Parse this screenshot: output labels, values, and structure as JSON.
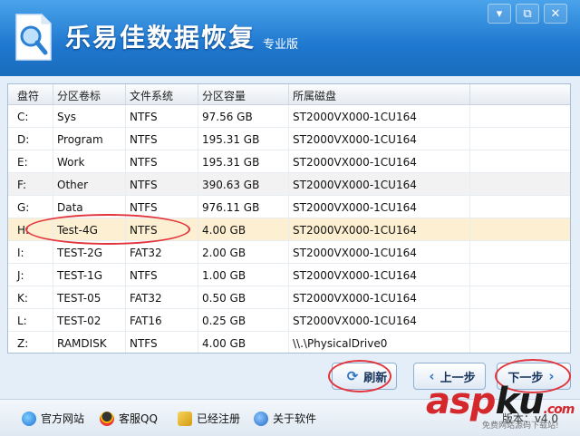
{
  "app": {
    "title": "乐易佳数据恢复",
    "edition": "专业版"
  },
  "window_controls": {
    "menu": "▾",
    "restore": "⧉",
    "close": "✕"
  },
  "table": {
    "headers": [
      "盘符",
      "分区卷标",
      "文件系统",
      "分区容量",
      "所属磁盘"
    ],
    "rows": [
      [
        "C:",
        "Sys",
        "NTFS",
        "97.56 GB",
        "ST2000VX000-1CU164"
      ],
      [
        "D:",
        "Program",
        "NTFS",
        "195.31 GB",
        "ST2000VX000-1CU164"
      ],
      [
        "E:",
        "Work",
        "NTFS",
        "195.31 GB",
        "ST2000VX000-1CU164"
      ],
      [
        "F:",
        "Other",
        "NTFS",
        "390.63 GB",
        "ST2000VX000-1CU164"
      ],
      [
        "G:",
        "Data",
        "NTFS",
        "976.11 GB",
        "ST2000VX000-1CU164"
      ],
      [
        "H:",
        "Test-4G",
        "NTFS",
        "4.00 GB",
        "ST2000VX000-1CU164"
      ],
      [
        "I:",
        "TEST-2G",
        "FAT32",
        "2.00 GB",
        "ST2000VX000-1CU164"
      ],
      [
        "J:",
        "TEST-1G",
        "NTFS",
        "1.00 GB",
        "ST2000VX000-1CU164"
      ],
      [
        "K:",
        "TEST-05",
        "FAT32",
        "0.50 GB",
        "ST2000VX000-1CU164"
      ],
      [
        "L:",
        "TEST-02",
        "FAT16",
        "0.25 GB",
        "ST2000VX000-1CU164"
      ],
      [
        "Z:",
        "RAMDISK",
        "NTFS",
        "4.00 GB",
        "\\\\.\\PhysicalDrive0"
      ]
    ],
    "selected_row": 5,
    "highlight_row": 3
  },
  "buttons": {
    "refresh": "刷新",
    "prev": "上一步",
    "next": "下一步"
  },
  "status_bar": {
    "website": "官方网站",
    "qq": "客服QQ",
    "registered": "已经注册",
    "about": "关于软件",
    "version": "版本：v4.0"
  },
  "watermark": {
    "asp": "asp",
    "ku": "ku",
    "dot": ".com",
    "sub": "免费网站源码下载站!"
  },
  "colors": {
    "titlebar": "#1f78cf",
    "selected_row": "#fdf0d2",
    "annotation": "#e2343c",
    "watermark": "#d4282d"
  }
}
